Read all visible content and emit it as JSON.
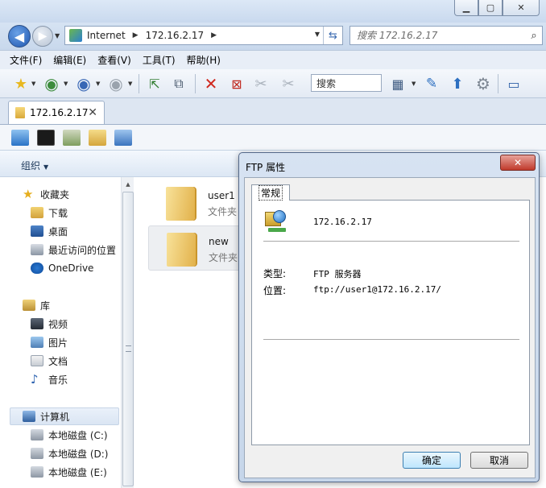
{
  "address": {
    "segments": [
      "Internet",
      "172.16.2.17"
    ],
    "search_placeholder": "搜索 172.16.2.17"
  },
  "menu": [
    "文件(F)",
    "编辑(E)",
    "查看(V)",
    "工具(T)",
    "帮助(H)"
  ],
  "toolbar": {
    "search_value": "搜索"
  },
  "tab": {
    "label": "172.16.2.17",
    "close_glyph": "✕"
  },
  "cmdbar": {
    "organize_label": "组织"
  },
  "nav": {
    "favorites": "收藏夹",
    "downloads": "下载",
    "desktop": "桌面",
    "recent": "最近访问的位置",
    "onedrive": "OneDrive",
    "library": "库",
    "videos": "视频",
    "pictures": "图片",
    "documents": "文档",
    "music": "音乐",
    "computer": "计算机",
    "drive_c": "本地磁盘 (C:)",
    "drive_d": "本地磁盘 (D:)",
    "drive_e": "本地磁盘 (E:)"
  },
  "folders": [
    {
      "name": "user1",
      "type": "文件夹"
    },
    {
      "name": "new",
      "type": "文件夹"
    }
  ],
  "dialog": {
    "title": "FTP 属性",
    "tab": "常规",
    "host": "172.16.2.17",
    "type_label": "类型:",
    "type_value": "FTP 服务器",
    "location_label": "位置:",
    "location_value": "ftp://user1@172.16.2.17/",
    "ok_label": "确定",
    "cancel_label": "取消"
  },
  "icons": {
    "back": "back-arrow-icon",
    "forward": "forward-arrow-icon",
    "refresh": "refresh-icon",
    "search": "search-icon"
  }
}
